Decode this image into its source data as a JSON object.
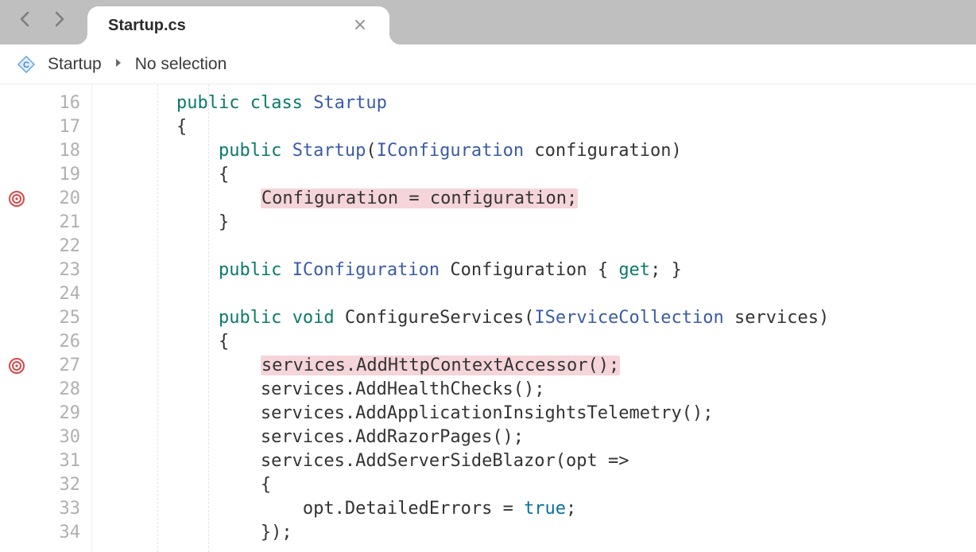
{
  "tab": {
    "title": "Startup.cs"
  },
  "breadcrumb": {
    "item1": "Startup",
    "item2": "No selection"
  },
  "lines": {
    "n16": "16",
    "n17": "17",
    "n18": "18",
    "n19": "19",
    "n20": "20",
    "n21": "21",
    "n22": "22",
    "n23": "23",
    "n24": "24",
    "n25": "25",
    "n26": "26",
    "n27": "27",
    "n28": "28",
    "n29": "29",
    "n30": "30",
    "n31": "31",
    "n32": "32",
    "n33": "33",
    "n34": "34"
  },
  "code": {
    "l16": {
      "ind": "        ",
      "kw1": "public",
      "sp1": " ",
      "kw2": "class",
      "sp2": " ",
      "name": "Startup"
    },
    "l17": {
      "ind": "        ",
      "brace": "{"
    },
    "l18": {
      "ind": "            ",
      "kw1": "public",
      "sp1": " ",
      "name": "Startup",
      "paren1": "(",
      "type": "IConfiguration",
      "sp2": " ",
      "param": "configuration",
      "paren2": ")"
    },
    "l19": {
      "ind": "            ",
      "brace": "{"
    },
    "l20": {
      "ind": "                ",
      "hl": "Configuration = configuration;"
    },
    "l21": {
      "ind": "            ",
      "brace": "}"
    },
    "l22": {
      "ind": ""
    },
    "l23": {
      "ind": "            ",
      "kw1": "public",
      "sp1": " ",
      "type": "IConfiguration",
      "sp2": " ",
      "name": "Configuration",
      "sp3": " ",
      "brace1": "{",
      "sp4": " ",
      "kw2": "get",
      "semi": ";",
      "sp5": " ",
      "brace2": "}"
    },
    "l24": {
      "ind": ""
    },
    "l25": {
      "ind": "            ",
      "kw1": "public",
      "sp1": " ",
      "kw2": "void",
      "sp2": " ",
      "name": "ConfigureServices",
      "paren1": "(",
      "type": "IServiceCollection",
      "sp3": " ",
      "param": "services",
      "paren2": ")"
    },
    "l26": {
      "ind": "            ",
      "brace": "{"
    },
    "l27": {
      "ind": "                ",
      "hl": "services.AddHttpContextAccessor();"
    },
    "l28": {
      "ind": "                ",
      "txt": "services.AddHealthChecks();"
    },
    "l29": {
      "ind": "                ",
      "txt": "services.AddApplicationInsightsTelemetry();"
    },
    "l30": {
      "ind": "                ",
      "txt": "services.AddRazorPages();"
    },
    "l31": {
      "ind": "                ",
      "txt": "services.AddServerSideBlazor(opt =>"
    },
    "l32": {
      "ind": "                ",
      "brace": "{"
    },
    "l33": {
      "ind": "                    ",
      "p1": "opt.DetailedErrors = ",
      "kw": "true",
      "p2": ";"
    },
    "l34": {
      "ind": "                ",
      "txt": "});"
    }
  },
  "markers": {
    "m20_line": 20,
    "m27_line": 27
  }
}
